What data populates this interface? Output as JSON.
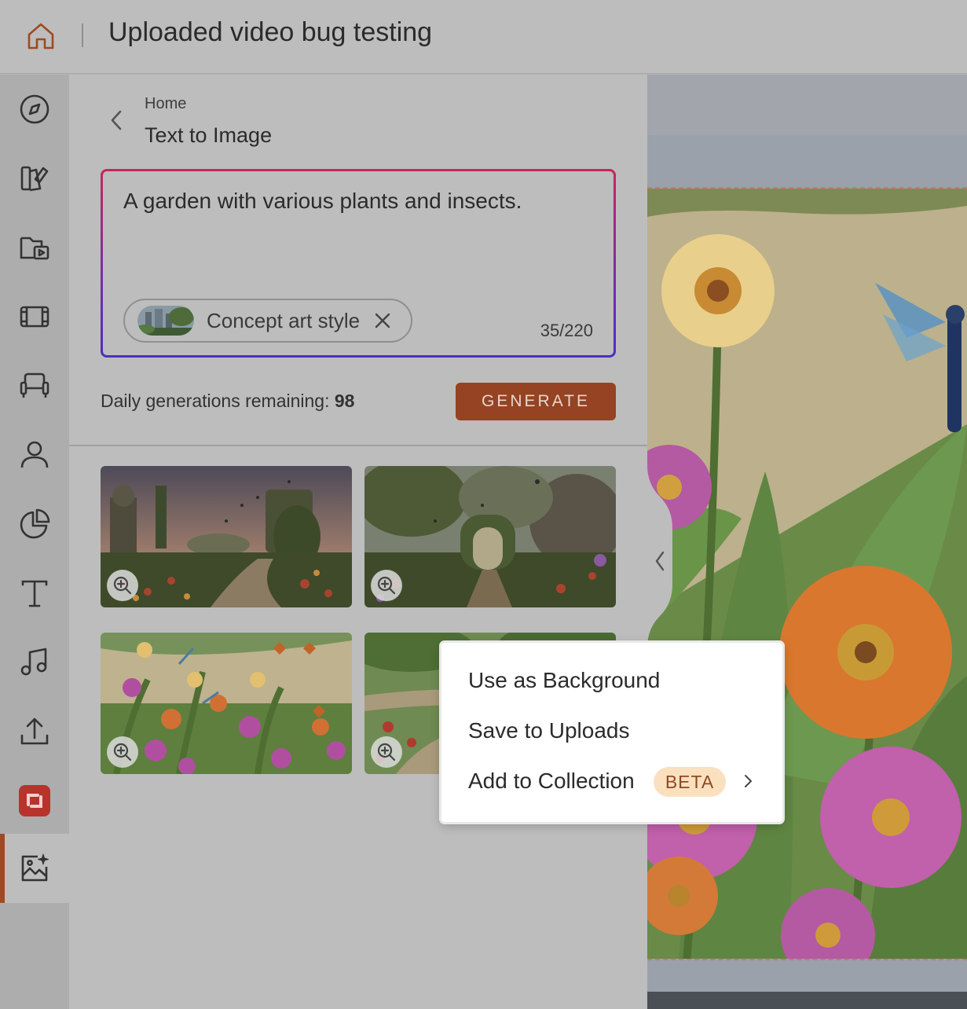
{
  "header": {
    "title": "Uploaded video bug testing",
    "home_icon": "home-icon"
  },
  "sidebar": {
    "items": [
      {
        "name": "compass-icon"
      },
      {
        "name": "design-tools-icon"
      },
      {
        "name": "media-folder-icon"
      },
      {
        "name": "video-clips-icon"
      },
      {
        "name": "furniture-icon"
      },
      {
        "name": "character-icon"
      },
      {
        "name": "chart-icon"
      },
      {
        "name": "text-icon"
      },
      {
        "name": "music-icon"
      },
      {
        "name": "upload-icon"
      },
      {
        "name": "brand-app-icon"
      },
      {
        "name": "ai-image-icon",
        "active": true
      }
    ],
    "accent_color": "#a04922"
  },
  "panel": {
    "breadcrumb": "Home",
    "title": "Text to Image",
    "prompt": {
      "text": "A garden with various plants and insects.",
      "style_chip": "Concept art style",
      "char_count": "35/220"
    },
    "daily_label": "Daily generations remaining:",
    "daily_value": "98",
    "generate_label": "GENERATE",
    "results": [
      {
        "name": "result-image-1"
      },
      {
        "name": "result-image-2"
      },
      {
        "name": "result-image-3"
      },
      {
        "name": "result-image-4"
      }
    ]
  },
  "context_menu": {
    "items": [
      {
        "label": "Use as Background"
      },
      {
        "label": "Save to Uploads"
      },
      {
        "label": "Add to Collection",
        "badge": "BETA"
      }
    ]
  }
}
